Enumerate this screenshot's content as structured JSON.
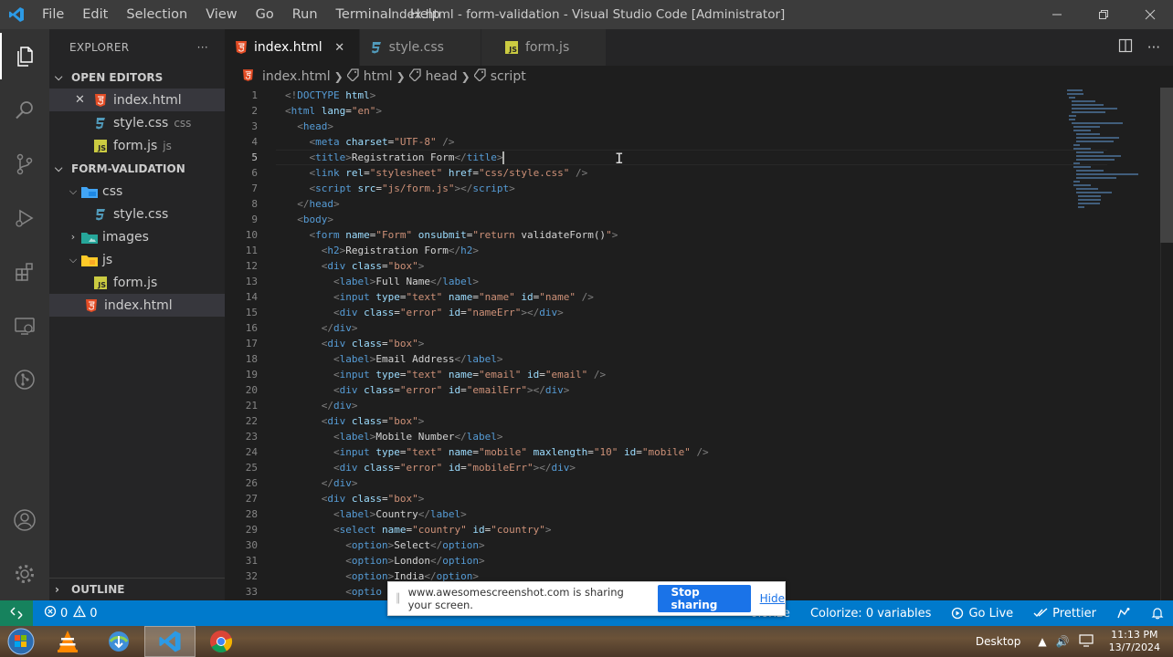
{
  "titlebar": {
    "menu": [
      "File",
      "Edit",
      "Selection",
      "View",
      "Go",
      "Run",
      "Terminal",
      "Help"
    ],
    "title": "index.html - form-validation - Visual Studio Code [Administrator]"
  },
  "sidebar": {
    "header": "EXPLORER",
    "open_editors_label": "OPEN EDITORS",
    "open_editors": [
      {
        "name": "index.html",
        "hint": ""
      },
      {
        "name": "style.css",
        "hint": "css"
      },
      {
        "name": "form.js",
        "hint": "js"
      }
    ],
    "project_label": "FORM-VALIDATION",
    "tree": [
      {
        "name": "css"
      },
      {
        "name": "style.css"
      },
      {
        "name": "images"
      },
      {
        "name": "js"
      },
      {
        "name": "form.js"
      },
      {
        "name": "index.html"
      }
    ],
    "outline_label": "OUTLINE"
  },
  "tabs": [
    {
      "label": "index.html"
    },
    {
      "label": "style.css"
    },
    {
      "label": "form.js"
    }
  ],
  "breadcrumb": [
    "index.html",
    "html",
    "head",
    "script"
  ],
  "editor": {
    "lines": [
      [
        [
          "p",
          "<!"
        ],
        [
          "t",
          "DOCTYPE"
        ],
        [
          "tx",
          " "
        ],
        [
          "a",
          "html"
        ],
        [
          "p",
          ">"
        ]
      ],
      [
        [
          "p",
          "<"
        ],
        [
          "t",
          "html"
        ],
        [
          "tx",
          " "
        ],
        [
          "a",
          "lang"
        ],
        [
          "tx",
          "="
        ],
        [
          "s",
          "\"en\""
        ],
        [
          "p",
          ">"
        ]
      ],
      [
        [
          "tx",
          "  "
        ],
        [
          "p",
          "<"
        ],
        [
          "t",
          "head"
        ],
        [
          "p",
          ">"
        ]
      ],
      [
        [
          "tx",
          "    "
        ],
        [
          "p",
          "<"
        ],
        [
          "t",
          "meta"
        ],
        [
          "tx",
          " "
        ],
        [
          "a",
          "charset"
        ],
        [
          "tx",
          "="
        ],
        [
          "s",
          "\"UTF-8\""
        ],
        [
          "tx",
          " "
        ],
        [
          "p",
          "/>"
        ]
      ],
      [
        [
          "tx",
          "    "
        ],
        [
          "p",
          "<"
        ],
        [
          "t",
          "title"
        ],
        [
          "p",
          ">"
        ],
        [
          "tx",
          "Registration Form"
        ],
        [
          "p",
          "</"
        ],
        [
          "t",
          "title"
        ],
        [
          "p",
          ">"
        ]
      ],
      [
        [
          "tx",
          "    "
        ],
        [
          "p",
          "<"
        ],
        [
          "t",
          "link"
        ],
        [
          "tx",
          " "
        ],
        [
          "a",
          "rel"
        ],
        [
          "tx",
          "="
        ],
        [
          "s",
          "\"stylesheet\""
        ],
        [
          "tx",
          " "
        ],
        [
          "a",
          "href"
        ],
        [
          "tx",
          "="
        ],
        [
          "s",
          "\"css/style.css\""
        ],
        [
          "tx",
          " "
        ],
        [
          "p",
          "/>"
        ]
      ],
      [
        [
          "tx",
          "    "
        ],
        [
          "p",
          "<"
        ],
        [
          "t",
          "script"
        ],
        [
          "tx",
          " "
        ],
        [
          "a",
          "src"
        ],
        [
          "tx",
          "="
        ],
        [
          "s",
          "\"js/form.js\""
        ],
        [
          "p",
          "></"
        ],
        [
          "t",
          "script"
        ],
        [
          "p",
          ">"
        ]
      ],
      [
        [
          "tx",
          "  "
        ],
        [
          "p",
          "</"
        ],
        [
          "t",
          "head"
        ],
        [
          "p",
          ">"
        ]
      ],
      [
        [
          "tx",
          "  "
        ],
        [
          "p",
          "<"
        ],
        [
          "t",
          "body"
        ],
        [
          "p",
          ">"
        ]
      ],
      [
        [
          "tx",
          "    "
        ],
        [
          "p",
          "<"
        ],
        [
          "t",
          "form"
        ],
        [
          "tx",
          " "
        ],
        [
          "a",
          "name"
        ],
        [
          "tx",
          "="
        ],
        [
          "s",
          "\"Form\""
        ],
        [
          "tx",
          " "
        ],
        [
          "a",
          "onsubmit"
        ],
        [
          "tx",
          "="
        ],
        [
          "s",
          "\"return "
        ],
        [
          "tx",
          "validateForm()"
        ],
        [
          "s",
          "\""
        ],
        [
          "p",
          ">"
        ]
      ],
      [
        [
          "tx",
          "      "
        ],
        [
          "p",
          "<"
        ],
        [
          "t",
          "h2"
        ],
        [
          "p",
          ">"
        ],
        [
          "tx",
          "Registration Form"
        ],
        [
          "p",
          "</"
        ],
        [
          "t",
          "h2"
        ],
        [
          "p",
          ">"
        ]
      ],
      [
        [
          "tx",
          "      "
        ],
        [
          "p",
          "<"
        ],
        [
          "t",
          "div"
        ],
        [
          "tx",
          " "
        ],
        [
          "a",
          "class"
        ],
        [
          "tx",
          "="
        ],
        [
          "s",
          "\"box\""
        ],
        [
          "p",
          ">"
        ]
      ],
      [
        [
          "tx",
          "        "
        ],
        [
          "p",
          "<"
        ],
        [
          "t",
          "label"
        ],
        [
          "p",
          ">"
        ],
        [
          "tx",
          "Full Name"
        ],
        [
          "p",
          "</"
        ],
        [
          "t",
          "label"
        ],
        [
          "p",
          ">"
        ]
      ],
      [
        [
          "tx",
          "        "
        ],
        [
          "p",
          "<"
        ],
        [
          "t",
          "input"
        ],
        [
          "tx",
          " "
        ],
        [
          "a",
          "type"
        ],
        [
          "tx",
          "="
        ],
        [
          "s",
          "\"text\""
        ],
        [
          "tx",
          " "
        ],
        [
          "a",
          "name"
        ],
        [
          "tx",
          "="
        ],
        [
          "s",
          "\"name\""
        ],
        [
          "tx",
          " "
        ],
        [
          "a",
          "id"
        ],
        [
          "tx",
          "="
        ],
        [
          "s",
          "\"name\""
        ],
        [
          "tx",
          " "
        ],
        [
          "p",
          "/>"
        ]
      ],
      [
        [
          "tx",
          "        "
        ],
        [
          "p",
          "<"
        ],
        [
          "t",
          "div"
        ],
        [
          "tx",
          " "
        ],
        [
          "a",
          "class"
        ],
        [
          "tx",
          "="
        ],
        [
          "s",
          "\"error\""
        ],
        [
          "tx",
          " "
        ],
        [
          "a",
          "id"
        ],
        [
          "tx",
          "="
        ],
        [
          "s",
          "\"nameErr\""
        ],
        [
          "p",
          "></"
        ],
        [
          "t",
          "div"
        ],
        [
          "p",
          ">"
        ]
      ],
      [
        [
          "tx",
          "      "
        ],
        [
          "p",
          "</"
        ],
        [
          "t",
          "div"
        ],
        [
          "p",
          ">"
        ]
      ],
      [
        [
          "tx",
          "      "
        ],
        [
          "p",
          "<"
        ],
        [
          "t",
          "div"
        ],
        [
          "tx",
          " "
        ],
        [
          "a",
          "class"
        ],
        [
          "tx",
          "="
        ],
        [
          "s",
          "\"box\""
        ],
        [
          "p",
          ">"
        ]
      ],
      [
        [
          "tx",
          "        "
        ],
        [
          "p",
          "<"
        ],
        [
          "t",
          "label"
        ],
        [
          "p",
          ">"
        ],
        [
          "tx",
          "Email Address"
        ],
        [
          "p",
          "</"
        ],
        [
          "t",
          "label"
        ],
        [
          "p",
          ">"
        ]
      ],
      [
        [
          "tx",
          "        "
        ],
        [
          "p",
          "<"
        ],
        [
          "t",
          "input"
        ],
        [
          "tx",
          " "
        ],
        [
          "a",
          "type"
        ],
        [
          "tx",
          "="
        ],
        [
          "s",
          "\"text\""
        ],
        [
          "tx",
          " "
        ],
        [
          "a",
          "name"
        ],
        [
          "tx",
          "="
        ],
        [
          "s",
          "\"email\""
        ],
        [
          "tx",
          " "
        ],
        [
          "a",
          "id"
        ],
        [
          "tx",
          "="
        ],
        [
          "s",
          "\"email\""
        ],
        [
          "tx",
          " "
        ],
        [
          "p",
          "/>"
        ]
      ],
      [
        [
          "tx",
          "        "
        ],
        [
          "p",
          "<"
        ],
        [
          "t",
          "div"
        ],
        [
          "tx",
          " "
        ],
        [
          "a",
          "class"
        ],
        [
          "tx",
          "="
        ],
        [
          "s",
          "\"error\""
        ],
        [
          "tx",
          " "
        ],
        [
          "a",
          "id"
        ],
        [
          "tx",
          "="
        ],
        [
          "s",
          "\"emailErr\""
        ],
        [
          "p",
          "></"
        ],
        [
          "t",
          "div"
        ],
        [
          "p",
          ">"
        ]
      ],
      [
        [
          "tx",
          "      "
        ],
        [
          "p",
          "</"
        ],
        [
          "t",
          "div"
        ],
        [
          "p",
          ">"
        ]
      ],
      [
        [
          "tx",
          "      "
        ],
        [
          "p",
          "<"
        ],
        [
          "t",
          "div"
        ],
        [
          "tx",
          " "
        ],
        [
          "a",
          "class"
        ],
        [
          "tx",
          "="
        ],
        [
          "s",
          "\"box\""
        ],
        [
          "p",
          ">"
        ]
      ],
      [
        [
          "tx",
          "        "
        ],
        [
          "p",
          "<"
        ],
        [
          "t",
          "label"
        ],
        [
          "p",
          ">"
        ],
        [
          "tx",
          "Mobile Number"
        ],
        [
          "p",
          "</"
        ],
        [
          "t",
          "label"
        ],
        [
          "p",
          ">"
        ]
      ],
      [
        [
          "tx",
          "        "
        ],
        [
          "p",
          "<"
        ],
        [
          "t",
          "input"
        ],
        [
          "tx",
          " "
        ],
        [
          "a",
          "type"
        ],
        [
          "tx",
          "="
        ],
        [
          "s",
          "\"text\""
        ],
        [
          "tx",
          " "
        ],
        [
          "a",
          "name"
        ],
        [
          "tx",
          "="
        ],
        [
          "s",
          "\"mobile\""
        ],
        [
          "tx",
          " "
        ],
        [
          "a",
          "maxlength"
        ],
        [
          "tx",
          "="
        ],
        [
          "s",
          "\"10\""
        ],
        [
          "tx",
          " "
        ],
        [
          "a",
          "id"
        ],
        [
          "tx",
          "="
        ],
        [
          "s",
          "\"mobile\""
        ],
        [
          "tx",
          " "
        ],
        [
          "p",
          "/>"
        ]
      ],
      [
        [
          "tx",
          "        "
        ],
        [
          "p",
          "<"
        ],
        [
          "t",
          "div"
        ],
        [
          "tx",
          " "
        ],
        [
          "a",
          "class"
        ],
        [
          "tx",
          "="
        ],
        [
          "s",
          "\"error\""
        ],
        [
          "tx",
          " "
        ],
        [
          "a",
          "id"
        ],
        [
          "tx",
          "="
        ],
        [
          "s",
          "\"mobileErr\""
        ],
        [
          "p",
          "></"
        ],
        [
          "t",
          "div"
        ],
        [
          "p",
          ">"
        ]
      ],
      [
        [
          "tx",
          "      "
        ],
        [
          "p",
          "</"
        ],
        [
          "t",
          "div"
        ],
        [
          "p",
          ">"
        ]
      ],
      [
        [
          "tx",
          "      "
        ],
        [
          "p",
          "<"
        ],
        [
          "t",
          "div"
        ],
        [
          "tx",
          " "
        ],
        [
          "a",
          "class"
        ],
        [
          "tx",
          "="
        ],
        [
          "s",
          "\"box\""
        ],
        [
          "p",
          ">"
        ]
      ],
      [
        [
          "tx",
          "        "
        ],
        [
          "p",
          "<"
        ],
        [
          "t",
          "label"
        ],
        [
          "p",
          ">"
        ],
        [
          "tx",
          "Country"
        ],
        [
          "p",
          "</"
        ],
        [
          "t",
          "label"
        ],
        [
          "p",
          ">"
        ]
      ],
      [
        [
          "tx",
          "        "
        ],
        [
          "p",
          "<"
        ],
        [
          "t",
          "select"
        ],
        [
          "tx",
          " "
        ],
        [
          "a",
          "name"
        ],
        [
          "tx",
          "="
        ],
        [
          "s",
          "\"country\""
        ],
        [
          "tx",
          " "
        ],
        [
          "a",
          "id"
        ],
        [
          "tx",
          "="
        ],
        [
          "s",
          "\"country\""
        ],
        [
          "p",
          ">"
        ]
      ],
      [
        [
          "tx",
          "          "
        ],
        [
          "p",
          "<"
        ],
        [
          "t",
          "option"
        ],
        [
          "p",
          ">"
        ],
        [
          "tx",
          "Select"
        ],
        [
          "p",
          "</"
        ],
        [
          "t",
          "option"
        ],
        [
          "p",
          ">"
        ]
      ],
      [
        [
          "tx",
          "          "
        ],
        [
          "p",
          "<"
        ],
        [
          "t",
          "option"
        ],
        [
          "p",
          ">"
        ],
        [
          "tx",
          "London"
        ],
        [
          "p",
          "</"
        ],
        [
          "t",
          "option"
        ],
        [
          "p",
          ">"
        ]
      ],
      [
        [
          "tx",
          "          "
        ],
        [
          "p",
          "<"
        ],
        [
          "t",
          "option"
        ],
        [
          "p",
          ">"
        ],
        [
          "tx",
          "India"
        ],
        [
          "p",
          "</"
        ],
        [
          "t",
          "option"
        ],
        [
          "p",
          ">"
        ]
      ],
      [
        [
          "tx",
          "          "
        ],
        [
          "p",
          "<"
        ],
        [
          "t",
          "optio"
        ]
      ]
    ],
    "current_line": 5
  },
  "statusbar": {
    "errors": "0",
    "warnings": "0",
    "colorize": "Colorize: 0 variables",
    "colorize_short": "olorize",
    "go_live": "Go Live",
    "prettier": "Prettier"
  },
  "sharebar": {
    "message": "www.awesomescreenshot.com is sharing your screen.",
    "stop_label": "Stop sharing",
    "hide_label": "Hide"
  },
  "taskbar": {
    "desktop_label": "Desktop",
    "time": "11:13 PM",
    "date": "13/7/2024"
  },
  "colors": {
    "accent": "#007acc",
    "remote": "#16825d",
    "share_button": "#1a73e8"
  }
}
